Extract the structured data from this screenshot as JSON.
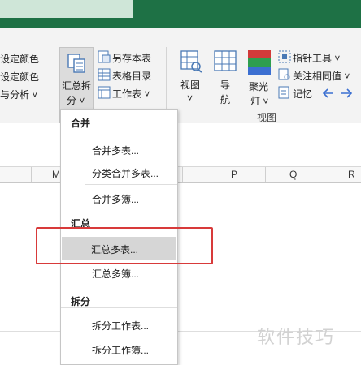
{
  "ribbon": {
    "left_items": [
      "设定颜色",
      "设定颜色",
      "与分析 ˅"
    ],
    "summary_split": {
      "line1": "汇总拆",
      "line2": "分 ˅"
    },
    "small_buttons": [
      "另存本表",
      "表格目录",
      "工作表 ˅"
    ],
    "view": {
      "label": "视图",
      "arrow": "˅"
    },
    "nav": {
      "line1": "导",
      "line2": "航"
    },
    "spotlight": {
      "line1": "聚光",
      "line2": "灯 ˅"
    },
    "right_items": [
      "指针工具 ˅",
      "关注相同值 ˅",
      "记忆"
    ],
    "group_label": "视图"
  },
  "columns": [
    "M",
    "P",
    "Q",
    "R"
  ],
  "menu": {
    "sections": [
      {
        "header": "合并",
        "items": [
          "合并多表...",
          "分类合并多表...",
          "合并多簿..."
        ]
      },
      {
        "header": "汇总",
        "items": [
          "汇总多表...",
          "汇总多簿..."
        ]
      },
      {
        "header": "拆分",
        "items": [
          "拆分工作表...",
          "拆分工作簿..."
        ]
      }
    ],
    "highlighted": "汇总多表..."
  },
  "watermark": "软件技巧",
  "colors": {
    "title_bar": "#1e7145",
    "ribbon_bg": "#f3f3f3",
    "highlight": "#d6d6d6",
    "callout": "#d83a3a"
  }
}
